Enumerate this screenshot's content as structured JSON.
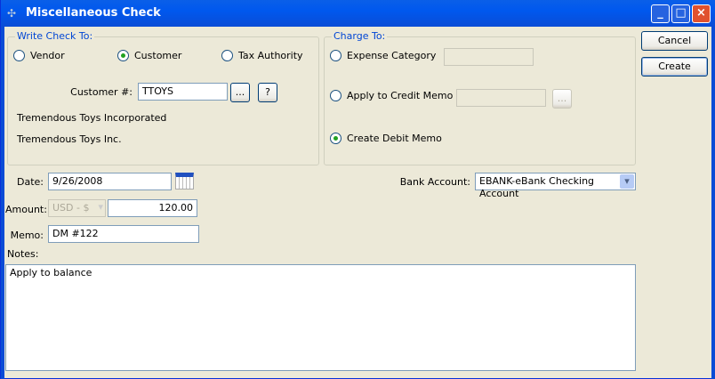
{
  "window": {
    "title": "Miscellaneous Check",
    "controls": [
      "_",
      "□",
      "×"
    ]
  },
  "write_check_to": {
    "legend": "Write Check To:",
    "options": [
      {
        "label": "Vendor",
        "selected": false
      },
      {
        "label": "Customer",
        "selected": true
      },
      {
        "label": "Tax Authority",
        "selected": false
      }
    ],
    "customer_label": "Customer #:",
    "customer_value": "TTOYS",
    "lookup_label": "...",
    "help_label": "?",
    "name1": "Tremendous Toys Incorporated",
    "name2": "Tremendous Toys Inc."
  },
  "charge_to": {
    "legend": "Charge To:",
    "expense_label": "Expense Category",
    "expense_value": "",
    "credit_memo_label": "Apply to Credit Memo",
    "credit_memo_value": "",
    "credit_lookup_label": "...",
    "debit_memo_label": "Create Debit Memo",
    "selected": "Create Debit Memo"
  },
  "buttons": {
    "cancel": "Cancel",
    "create": "Create"
  },
  "form": {
    "date_label": "Date:",
    "date_value": "9/26/2008",
    "amount_label": "Amount:",
    "currency": "USD - $",
    "amount_value": "120.00",
    "memo_label": "Memo:",
    "memo_value": "DM #122",
    "notes_label": "Notes:",
    "notes_value": "Apply to balance",
    "bank_label": "Bank Account:",
    "bank_value": "EBANK-eBank Checking Account"
  }
}
